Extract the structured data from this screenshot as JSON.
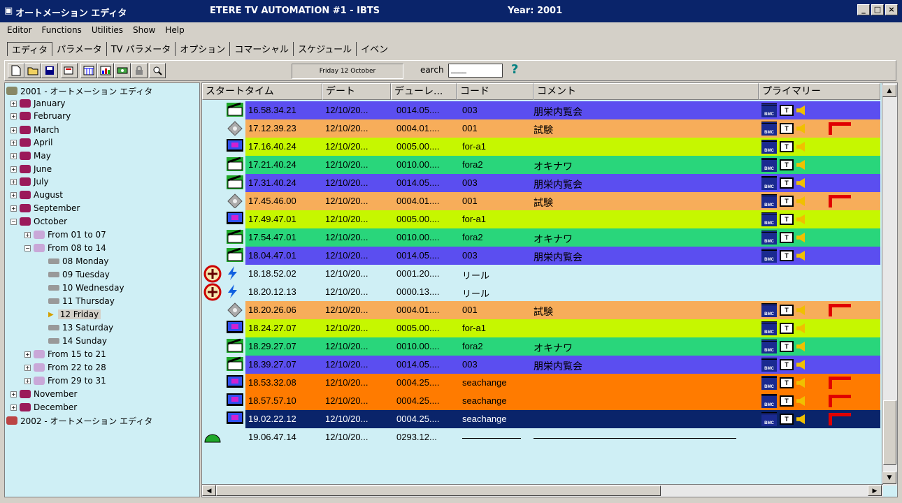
{
  "window": {
    "app_title": "オートメーション エディタ",
    "center_title": "ETERE TV AUTOMATION #1 - IBTS",
    "year": "Year: 2001"
  },
  "menu": [
    "Editor",
    "Functions",
    "Utilities",
    "Show",
    "Help"
  ],
  "tabs": [
    "エディタ",
    "パラメータ",
    "TV パラメータ",
    "オプション",
    "コマーシャル",
    "スケジュール",
    "イベン"
  ],
  "toolbar": {
    "date": "Friday 12 October",
    "search_label": "earch",
    "search_value": "____",
    "help": "?"
  },
  "tree": {
    "root": "2001 - オートメーション エディタ",
    "months": [
      "January",
      "February",
      "March",
      "April",
      "May",
      "June",
      "July",
      "August",
      "September",
      "October"
    ],
    "weeks_before": [
      "From 01 to 07",
      "From 08 to 14"
    ],
    "days": [
      "08 Monday",
      "09 Tuesday",
      "10 Wednesday",
      "11 Thursday",
      "12 Friday",
      "13 Saturday",
      "14 Sunday"
    ],
    "weeks_after": [
      "From 15 to 21",
      "From 22 to 28",
      "From 29 to 31"
    ],
    "months_after": [
      "November",
      "December"
    ],
    "root2": "2002 - オートメーション エディタ"
  },
  "grid": {
    "headers": [
      "スタートタイム",
      "デート",
      "デューレ...",
      "コード",
      "コメント",
      "プライマリー"
    ],
    "rows": [
      {
        "time": "16.58.34.21",
        "date": "12/10/20...",
        "dur": "0014.05....",
        "code": "003",
        "comment": "朋栄内覧会",
        "color": "#5b4ef0",
        "icon": "clap",
        "flag": false
      },
      {
        "time": "17.12.39.23",
        "date": "12/10/20...",
        "dur": "0004.01....",
        "code": "001",
        "comment": "試験",
        "color": "#f7ad5a",
        "icon": "tape",
        "flag": true
      },
      {
        "time": "17.16.40.24",
        "date": "12/10/20...",
        "dur": "0005.00....",
        "code": "for-a1",
        "comment": "",
        "color": "#c6f700",
        "icon": "monitor",
        "flag": false
      },
      {
        "time": "17.21.40.24",
        "date": "12/10/20...",
        "dur": "0010.00....",
        "code": "fora2",
        "comment": "オキナワ",
        "color": "#29d67b",
        "icon": "clap",
        "flag": false
      },
      {
        "time": "17.31.40.24",
        "date": "12/10/20...",
        "dur": "0014.05....",
        "code": "003",
        "comment": "朋栄内覧会",
        "color": "#5b4ef0",
        "icon": "clap",
        "flag": false
      },
      {
        "time": "17.45.46.00",
        "date": "12/10/20...",
        "dur": "0004.01....",
        "code": "001",
        "comment": "試験",
        "color": "#f7ad5a",
        "icon": "tape",
        "flag": true
      },
      {
        "time": "17.49.47.01",
        "date": "12/10/20...",
        "dur": "0005.00....",
        "code": "for-a1",
        "comment": "",
        "color": "#c6f700",
        "icon": "monitor",
        "flag": false
      },
      {
        "time": "17.54.47.01",
        "date": "12/10/20...",
        "dur": "0010.00....",
        "code": "fora2",
        "comment": "オキナワ",
        "color": "#29d67b",
        "icon": "clap",
        "flag": false
      },
      {
        "time": "18.04.47.01",
        "date": "12/10/20...",
        "dur": "0014.05....",
        "code": "003",
        "comment": "朋栄内覧会",
        "color": "#5b4ef0",
        "icon": "clap",
        "flag": false
      },
      {
        "time": "18.18.52.02",
        "date": "12/10/20...",
        "dur": "0001.20....",
        "code": "リール",
        "comment": "",
        "color": "#cfeff5",
        "icon": "bolt",
        "flag": false
      },
      {
        "time": "18.20.12.13",
        "date": "12/10/20...",
        "dur": "0000.13....",
        "code": "リール",
        "comment": "",
        "color": "#cfeff5",
        "icon": "bolt",
        "flag": false
      },
      {
        "time": "18.20.26.06",
        "date": "12/10/20...",
        "dur": "0004.01....",
        "code": "001",
        "comment": "試験",
        "color": "#f7ad5a",
        "icon": "tape",
        "flag": true
      },
      {
        "time": "18.24.27.07",
        "date": "12/10/20...",
        "dur": "0005.00....",
        "code": "for-a1",
        "comment": "",
        "color": "#c6f700",
        "icon": "monitor",
        "flag": false
      },
      {
        "time": "18.29.27.07",
        "date": "12/10/20...",
        "dur": "0010.00....",
        "code": "fora2",
        "comment": "オキナワ",
        "color": "#29d67b",
        "icon": "clap",
        "flag": false
      },
      {
        "time": "18.39.27.07",
        "date": "12/10/20...",
        "dur": "0014.05....",
        "code": "003",
        "comment": "朋栄内覧会",
        "color": "#5b4ef0",
        "icon": "clap",
        "flag": false
      },
      {
        "time": "18.53.32.08",
        "date": "12/10/20...",
        "dur": "0004.25....",
        "code": "seachange",
        "comment": "",
        "color": "#ff7b00",
        "icon": "monitor",
        "flag": true
      },
      {
        "time": "18.57.57.10",
        "date": "12/10/20...",
        "dur": "0004.25....",
        "code": "seachange",
        "comment": "",
        "color": "#ff7b00",
        "icon": "monitor",
        "flag": true
      },
      {
        "time": "19.02.22.12",
        "date": "12/10/20...",
        "dur": "0004.25....",
        "code": "seachange",
        "comment": "",
        "color": "#0a246a",
        "icon": "monitor",
        "flag": true,
        "selected": true
      },
      {
        "time": "19.06.47.14",
        "date": "12/10/20...",
        "dur": "0293.12...",
        "code": "",
        "comment": "",
        "color": "#cfeff5",
        "icon": "",
        "flag": false
      }
    ]
  }
}
